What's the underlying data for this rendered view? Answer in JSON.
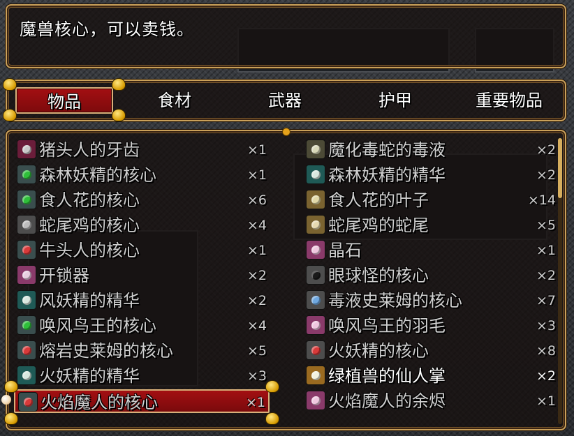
{
  "help": {
    "text": "魔兽核心，可以卖钱。"
  },
  "tabs": [
    {
      "label": "物品",
      "selected": true
    },
    {
      "label": "食材",
      "selected": false
    },
    {
      "label": "武器",
      "selected": false
    },
    {
      "label": "护甲",
      "selected": false
    },
    {
      "label": "重要物品",
      "selected": false
    }
  ],
  "items": [
    {
      "name": "猪头人的牙齿",
      "qty": "×1",
      "icon": "tooth-icon",
      "color": "#c9c9c9",
      "bg": "#6b1d3a"
    },
    {
      "name": "魔化毒蛇的毒液",
      "qty": "×2",
      "icon": "venom-icon",
      "color": "#d8d8b8",
      "bg": "#4c4a36"
    },
    {
      "name": "森林妖精的核心",
      "qty": "×1",
      "icon": "green-core-icon",
      "color": "#2fbf3a",
      "bg": "#3a4e4e"
    },
    {
      "name": "森林妖精的精华",
      "qty": "×2",
      "icon": "chalice-icon",
      "color": "#d9e8e0",
      "bg": "#1f5a56"
    },
    {
      "name": "食人花的核心",
      "qty": "×6",
      "icon": "green-core-icon",
      "color": "#2fbf3a",
      "bg": "#3a4e4e"
    },
    {
      "name": "食人花的叶子",
      "qty": "×14",
      "icon": "leaf-icon",
      "color": "#e2d9a8",
      "bg": "#7a6330"
    },
    {
      "name": "蛇尾鸡的核心",
      "qty": "×4",
      "icon": "gray-core-icon",
      "color": "#bdbdbd",
      "bg": "#4d4d4d"
    },
    {
      "name": "蛇尾鸡的蛇尾",
      "qty": "×5",
      "icon": "snake-tail-icon",
      "color": "#e6d9b0",
      "bg": "#7a6330"
    },
    {
      "name": "牛头人的核心",
      "qty": "×1",
      "icon": "red-core-icon",
      "color": "#d83a3a",
      "bg": "#3a4e4e"
    },
    {
      "name": "晶石",
      "qty": "×1",
      "icon": "crystal-icon",
      "color": "#f0c8e0",
      "bg": "#8a3a6a"
    },
    {
      "name": "开锁器",
      "qty": "×2",
      "icon": "lockpick-icon",
      "color": "#e8d0e0",
      "bg": "#8a3a6a"
    },
    {
      "name": "眼球怪的核心",
      "qty": "×2",
      "icon": "black-core-icon",
      "color": "#1a1a1a",
      "bg": "#4d4d4d"
    },
    {
      "name": "风妖精的精华",
      "qty": "×2",
      "icon": "chalice-icon",
      "color": "#d9e8e0",
      "bg": "#1f5a56"
    },
    {
      "name": "毒液史莱姆的核心",
      "qty": "×7",
      "icon": "blue-core-icon",
      "color": "#6fa8e0",
      "bg": "#4d4d4d"
    },
    {
      "name": "唤风鸟王的核心",
      "qty": "×4",
      "icon": "green-core-icon",
      "color": "#2fbf3a",
      "bg": "#3a4e4e"
    },
    {
      "name": "唤风鸟王的羽毛",
      "qty": "×3",
      "icon": "feather-icon",
      "color": "#f0c8e0",
      "bg": "#8a3a6a"
    },
    {
      "name": "熔岩史莱姆的核心",
      "qty": "×5",
      "icon": "red-core-icon",
      "color": "#d83a3a",
      "bg": "#3a4e4e"
    },
    {
      "name": "火妖精的核心",
      "qty": "×8",
      "icon": "red-core-icon",
      "color": "#d83a3a",
      "bg": "#4d4d4d"
    },
    {
      "name": "火妖精的精华",
      "qty": "×3",
      "icon": "chalice-icon",
      "color": "#d9e8e0",
      "bg": "#1f5a56"
    },
    {
      "name": "绿植兽的仙人掌",
      "qty": "×2",
      "icon": "cactus-icon",
      "color": "#f2f2e0",
      "bg": "#9a6a20"
    },
    {
      "name": "火焰魔人的核心",
      "qty": "×1",
      "icon": "red-core-icon",
      "color": "#d83a3a",
      "bg": "#3a4e4e"
    },
    {
      "name": "火焰魔人的余烬",
      "qty": "×1",
      "icon": "ember-icon",
      "color": "#f0c8e0",
      "bg": "#8a3a6a"
    }
  ],
  "cursor_index": 20,
  "bright_index": 19,
  "scroll": {
    "position": 0.0
  }
}
